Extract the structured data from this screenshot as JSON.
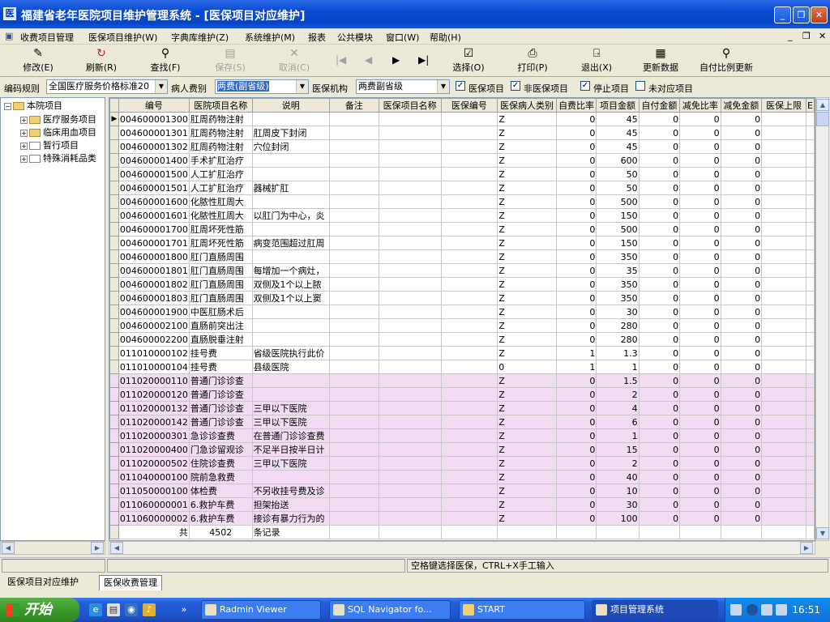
{
  "window": {
    "title": "福建省老年医院项目维护管理系统 - [医保项目对应维护]"
  },
  "menu": [
    "收费项目管理",
    "医保项目维护(W)",
    "字典库维护(Z)",
    "系统维护(M)",
    "报表",
    "公共模块",
    "窗口(W)",
    "帮助(H)"
  ],
  "toolbar": [
    {
      "label": "修改(E)",
      "icon": "edit-icon",
      "disabled": false
    },
    {
      "label": "刷新(R)",
      "icon": "refresh-icon",
      "disabled": false
    },
    {
      "label": "查找(F)",
      "icon": "find-icon",
      "disabled": false
    },
    {
      "label": "保存(S)",
      "icon": "save-icon",
      "disabled": true
    },
    {
      "label": "取消(C)",
      "icon": "cancel-icon",
      "disabled": true
    },
    {
      "label": "选择(O)",
      "icon": "select-icon",
      "disabled": false
    },
    {
      "label": "打印(P)",
      "icon": "print-icon",
      "disabled": false
    },
    {
      "label": "退出(X)",
      "icon": "exit-icon",
      "disabled": false
    },
    {
      "label": "更新数据",
      "icon": "update-icon",
      "disabled": false
    },
    {
      "label": "自付比例更新",
      "icon": "ratio-update-icon",
      "disabled": false
    }
  ],
  "filters": {
    "rule_label": "编码规则",
    "rule_value": "全国医疗服务价格标准20",
    "patient_fee_label": "病人费别",
    "patient_fee_value": "两费(副省级)",
    "institution_label": "医保机构",
    "institution_value": "两费副省级",
    "cb_medical": "医保项目",
    "cb_nonmedical": "非医保项目",
    "cb_stopped": "停止项目",
    "cb_unmatched": "未对应项目"
  },
  "tree": {
    "root": "本院项目",
    "children": [
      "医疗服务项目",
      "临床用血项目",
      "暂行项目",
      "特殊消耗品类"
    ]
  },
  "grid": {
    "columns": [
      "编号",
      "医院项目名称",
      "说明",
      "备注",
      "医保项目名称",
      "医保编号",
      "医保病人类别",
      "自费比率",
      "项目金额",
      "自付金额",
      "减免比率",
      "减免金额",
      "医保上限",
      "E"
    ],
    "rows": [
      {
        "id": "004600001300",
        "name": "肛周药物注射",
        "desc": "",
        "cat": "Z",
        "ratio": "0",
        "amt": "45",
        "self": "0",
        "red": "0",
        "redamt": "0",
        "pink": false
      },
      {
        "id": "004600001301",
        "name": "肛周药物注射",
        "desc": "肛周皮下封闭",
        "cat": "Z",
        "ratio": "0",
        "amt": "45",
        "self": "0",
        "red": "0",
        "redamt": "0",
        "pink": false
      },
      {
        "id": "004600001302",
        "name": "肛周药物注射",
        "desc": "穴位封闭",
        "cat": "Z",
        "ratio": "0",
        "amt": "45",
        "self": "0",
        "red": "0",
        "redamt": "0",
        "pink": false
      },
      {
        "id": "004600001400",
        "name": "手术扩肛治疗",
        "desc": "",
        "cat": "Z",
        "ratio": "0",
        "amt": "600",
        "self": "0",
        "red": "0",
        "redamt": "0",
        "pink": false
      },
      {
        "id": "004600001500",
        "name": "人工扩肛治疗",
        "desc": "",
        "cat": "Z",
        "ratio": "0",
        "amt": "50",
        "self": "0",
        "red": "0",
        "redamt": "0",
        "pink": false
      },
      {
        "id": "004600001501",
        "name": "人工扩肛治疗",
        "desc": "器械扩肛",
        "cat": "Z",
        "ratio": "0",
        "amt": "50",
        "self": "0",
        "red": "0",
        "redamt": "0",
        "pink": false
      },
      {
        "id": "004600001600",
        "name": "化脓性肛周大",
        "desc": "",
        "cat": "Z",
        "ratio": "0",
        "amt": "500",
        "self": "0",
        "red": "0",
        "redamt": "0",
        "pink": false
      },
      {
        "id": "004600001601",
        "name": "化脓性肛周大",
        "desc": "以肛门为中心，炎",
        "cat": "Z",
        "ratio": "0",
        "amt": "150",
        "self": "0",
        "red": "0",
        "redamt": "0",
        "pink": false
      },
      {
        "id": "004600001700",
        "name": "肛周坏死性筋",
        "desc": "",
        "cat": "Z",
        "ratio": "0",
        "amt": "500",
        "self": "0",
        "red": "0",
        "redamt": "0",
        "pink": false
      },
      {
        "id": "004600001701",
        "name": "肛周坏死性筋",
        "desc": "病变范围超过肛周",
        "cat": "Z",
        "ratio": "0",
        "amt": "150",
        "self": "0",
        "red": "0",
        "redamt": "0",
        "pink": false
      },
      {
        "id": "004600001800",
        "name": "肛门直肠周围",
        "desc": "",
        "cat": "Z",
        "ratio": "0",
        "amt": "350",
        "self": "0",
        "red": "0",
        "redamt": "0",
        "pink": false
      },
      {
        "id": "004600001801",
        "name": "肛门直肠周围",
        "desc": "每增加一个病灶，",
        "cat": "Z",
        "ratio": "0",
        "amt": "35",
        "self": "0",
        "red": "0",
        "redamt": "0",
        "pink": false
      },
      {
        "id": "004600001802",
        "name": "肛门直肠周围",
        "desc": "双侧及1个以上脓",
        "cat": "Z",
        "ratio": "0",
        "amt": "350",
        "self": "0",
        "red": "0",
        "redamt": "0",
        "pink": false
      },
      {
        "id": "004600001803",
        "name": "肛门直肠周围",
        "desc": "双侧及1个以上窦",
        "cat": "Z",
        "ratio": "0",
        "amt": "350",
        "self": "0",
        "red": "0",
        "redamt": "0",
        "pink": false
      },
      {
        "id": "004600001900",
        "name": "中医肛肠术后",
        "desc": "",
        "cat": "Z",
        "ratio": "0",
        "amt": "30",
        "self": "0",
        "red": "0",
        "redamt": "0",
        "pink": false
      },
      {
        "id": "004600002100",
        "name": "直肠前突出注",
        "desc": "",
        "cat": "Z",
        "ratio": "0",
        "amt": "280",
        "self": "0",
        "red": "0",
        "redamt": "0",
        "pink": false
      },
      {
        "id": "004600002200",
        "name": "直肠脱垂注射",
        "desc": "",
        "cat": "Z",
        "ratio": "0",
        "amt": "280",
        "self": "0",
        "red": "0",
        "redamt": "0",
        "pink": false
      },
      {
        "id": "011010000102",
        "name": "挂号费",
        "desc": "省级医院执行此价",
        "cat": "Z",
        "ratio": "1",
        "amt": "1.3",
        "self": "0",
        "red": "0",
        "redamt": "0",
        "pink": false
      },
      {
        "id": "011010000104",
        "name": "挂号费",
        "desc": "县级医院",
        "cat": "0",
        "ratio": "1",
        "amt": "1",
        "self": "0",
        "red": "0",
        "redamt": "0",
        "pink": false
      },
      {
        "id": "011020000110",
        "name": "普通门诊诊查",
        "desc": "",
        "cat": "Z",
        "ratio": "0",
        "amt": "1.5",
        "self": "0",
        "red": "0",
        "redamt": "0",
        "pink": true
      },
      {
        "id": "011020000120",
        "name": "普通门诊诊查",
        "desc": "",
        "cat": "Z",
        "ratio": "0",
        "amt": "2",
        "self": "0",
        "red": "0",
        "redamt": "0",
        "pink": true
      },
      {
        "id": "011020000132",
        "name": "普通门诊诊查",
        "desc": "三甲以下医院",
        "cat": "Z",
        "ratio": "0",
        "amt": "4",
        "self": "0",
        "red": "0",
        "redamt": "0",
        "pink": true
      },
      {
        "id": "011020000142",
        "name": "普通门诊诊查",
        "desc": "三甲以下医院",
        "cat": "Z",
        "ratio": "0",
        "amt": "6",
        "self": "0",
        "red": "0",
        "redamt": "0",
        "pink": true
      },
      {
        "id": "011020000301",
        "name": "急诊诊查费",
        "desc": "在普通门诊诊查费",
        "cat": "Z",
        "ratio": "0",
        "amt": "1",
        "self": "0",
        "red": "0",
        "redamt": "0",
        "pink": true
      },
      {
        "id": "011020000400",
        "name": "门急诊留观诊",
        "desc": "不足半日按半日计",
        "cat": "Z",
        "ratio": "0",
        "amt": "15",
        "self": "0",
        "red": "0",
        "redamt": "0",
        "pink": true
      },
      {
        "id": "011020000502",
        "name": "住院诊查费",
        "desc": "三甲以下医院",
        "cat": "Z",
        "ratio": "0",
        "amt": "2",
        "self": "0",
        "red": "0",
        "redamt": "0",
        "pink": true
      },
      {
        "id": "011040000100",
        "name": "院前急救费",
        "desc": "",
        "cat": "Z",
        "ratio": "0",
        "amt": "40",
        "self": "0",
        "red": "0",
        "redamt": "0",
        "pink": true
      },
      {
        "id": "011050000100",
        "name": "体检费",
        "desc": "不另收挂号费及诊",
        "cat": "Z",
        "ratio": "0",
        "amt": "10",
        "self": "0",
        "red": "0",
        "redamt": "0",
        "pink": true
      },
      {
        "id": "011060000001",
        "name": "6.救护车费",
        "desc": "担架抬送",
        "cat": "Z",
        "ratio": "0",
        "amt": "30",
        "self": "0",
        "red": "0",
        "redamt": "0",
        "pink": true
      },
      {
        "id": "011060000002",
        "name": "6.救护车费",
        "desc": "接诊有暴力行为的",
        "cat": "Z",
        "ratio": "0",
        "amt": "100",
        "self": "0",
        "red": "0",
        "redamt": "0",
        "pink": true
      }
    ],
    "footer": {
      "prefix": "共",
      "count": "4502",
      "suffix": "条记录"
    }
  },
  "status": {
    "hint": "空格键选择医保，CTRL+X手工输入"
  },
  "tabs": [
    "医保项目对应维护",
    "医保收费管理"
  ],
  "taskbar": {
    "start": "开始",
    "tasks": [
      "Radmin Viewer",
      "SQL Navigator fo...",
      "START",
      "项目管理系统"
    ],
    "clock": "16:51"
  }
}
